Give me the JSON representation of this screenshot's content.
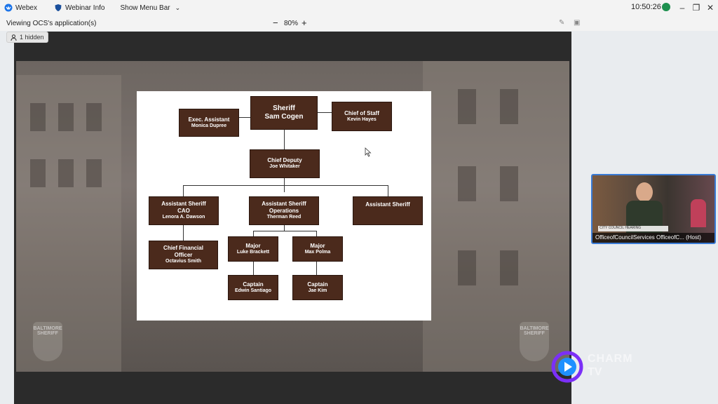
{
  "titlebar": {
    "app_name": "Webex",
    "webinar_info": "Webinar Info",
    "show_menu_bar": "Show Menu Bar",
    "clock": "10:50:26",
    "status_icon": "status-dot-green"
  },
  "viewbar": {
    "title": "Viewing OCS's application(s)",
    "zoom_value": "80%",
    "zoom_minus": "−",
    "zoom_plus": "+"
  },
  "hidden_badge": {
    "label": "1 hidden"
  },
  "org_chart": {
    "sheriff_title": "Sheriff",
    "sheriff_name": "Sam Cogen",
    "exec_title": "Exec. Assistant",
    "exec_name": "Monica Dupree",
    "cos_title": "Chief of Staff",
    "cos_name": "Kevin Hayes",
    "deputy_title": "Chief Deputy",
    "deputy_name": "Joe Whitaker",
    "cao_title1": "Assistant Sheriff",
    "cao_title2": "CAO",
    "cao_name": "Lenora A. Dawson",
    "ops_title1": "Assistant Sheriff",
    "ops_title2": "Operations",
    "ops_name": "Therman Reed",
    "asst_title": "Assistant Sheriff",
    "cfo_title1": "Chief Financial",
    "cfo_title2": "Officer",
    "cfo_name": "Octavius Smith",
    "major1_title": "Major",
    "major1_name": "Luke Brackett",
    "major2_title": "Major",
    "major2_name": "Max Polma",
    "capt1_title": "Captain",
    "capt1_name": "Edwin Santiago",
    "capt2_title": "Captain",
    "capt2_name": "Jae Kim"
  },
  "slide_logos": {
    "sheriff_badge": "BALTIMORE SHERIFF",
    "charm_text1": "CHARM",
    "charm_text2": "TV"
  },
  "thumbnail": {
    "label": "OfficeofCouncilServices OfficeofC... (Host)",
    "banner": "CITY COUNCIL HEARING"
  },
  "colors": {
    "box_brown": "#4b2a1c",
    "accent_blue": "#3a7bd5"
  }
}
